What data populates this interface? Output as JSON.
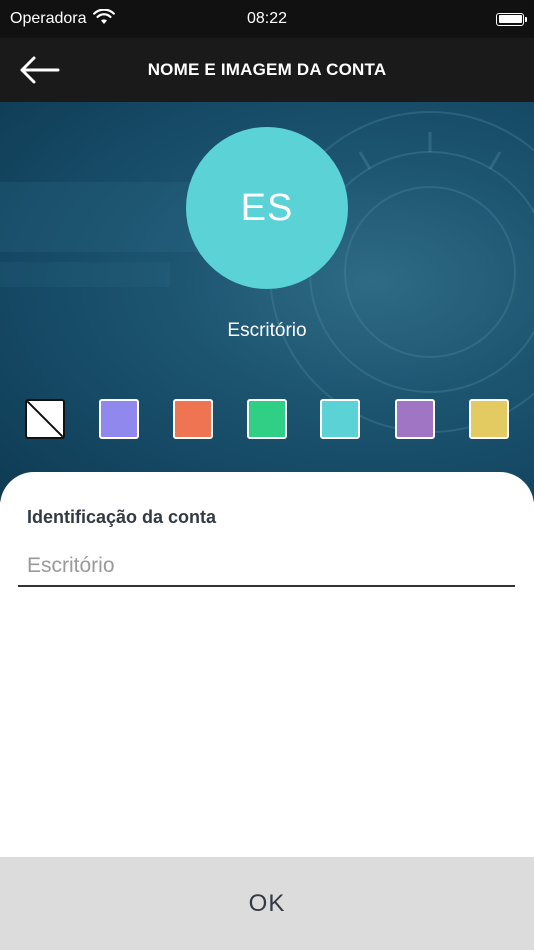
{
  "status_bar": {
    "carrier": "Operadora",
    "time": "08:22",
    "icons": [
      "wifi-icon",
      "battery-icon"
    ]
  },
  "header": {
    "title": "NOME E IMAGEM DA CONTA",
    "back_icon": "arrow-left-icon"
  },
  "account": {
    "initials": "ES",
    "name": "Escritório",
    "avatar_color": "#5bd3d6"
  },
  "color_options": [
    {
      "name": "none",
      "color": "#ffffff"
    },
    {
      "name": "lavender",
      "color": "#9188ee"
    },
    {
      "name": "orange",
      "color": "#ef7552"
    },
    {
      "name": "green",
      "color": "#30cf86"
    },
    {
      "name": "cyan",
      "color": "#5bd3d6"
    },
    {
      "name": "purple",
      "color": "#a076c4"
    },
    {
      "name": "yellow",
      "color": "#e3cb62"
    }
  ],
  "form": {
    "label": "Identificação da conta",
    "placeholder": "Escritório",
    "value": ""
  },
  "actions": {
    "ok_label": "OK"
  }
}
